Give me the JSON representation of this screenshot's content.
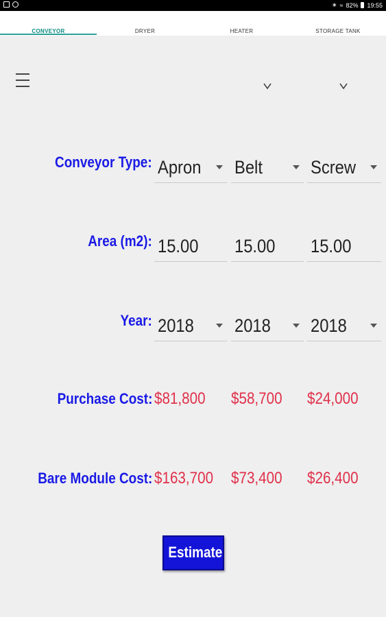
{
  "status": {
    "battery": "82%",
    "time": "19:55"
  },
  "tabs": [
    "CONVEYOR",
    "DRYER",
    "HEATER",
    "STORAGE TANK"
  ],
  "labels": {
    "type": "Conveyor Type:",
    "area": "Area (m2):",
    "year": "Year:",
    "purchase": "Purchase Cost:",
    "bare": "Bare Module Cost:"
  },
  "columns": [
    {
      "type": "Apron",
      "area": "15.00",
      "year": "2018",
      "purchase": "$81,800",
      "bare": "$163,700"
    },
    {
      "type": "Belt",
      "area": "15.00",
      "year": "2018",
      "purchase": "$58,700",
      "bare": "$73,400"
    },
    {
      "type": "Screw",
      "area": "15.00",
      "year": "2018",
      "purchase": "$24,000",
      "bare": "$26,400"
    }
  ],
  "estimate_label": "Estimate"
}
